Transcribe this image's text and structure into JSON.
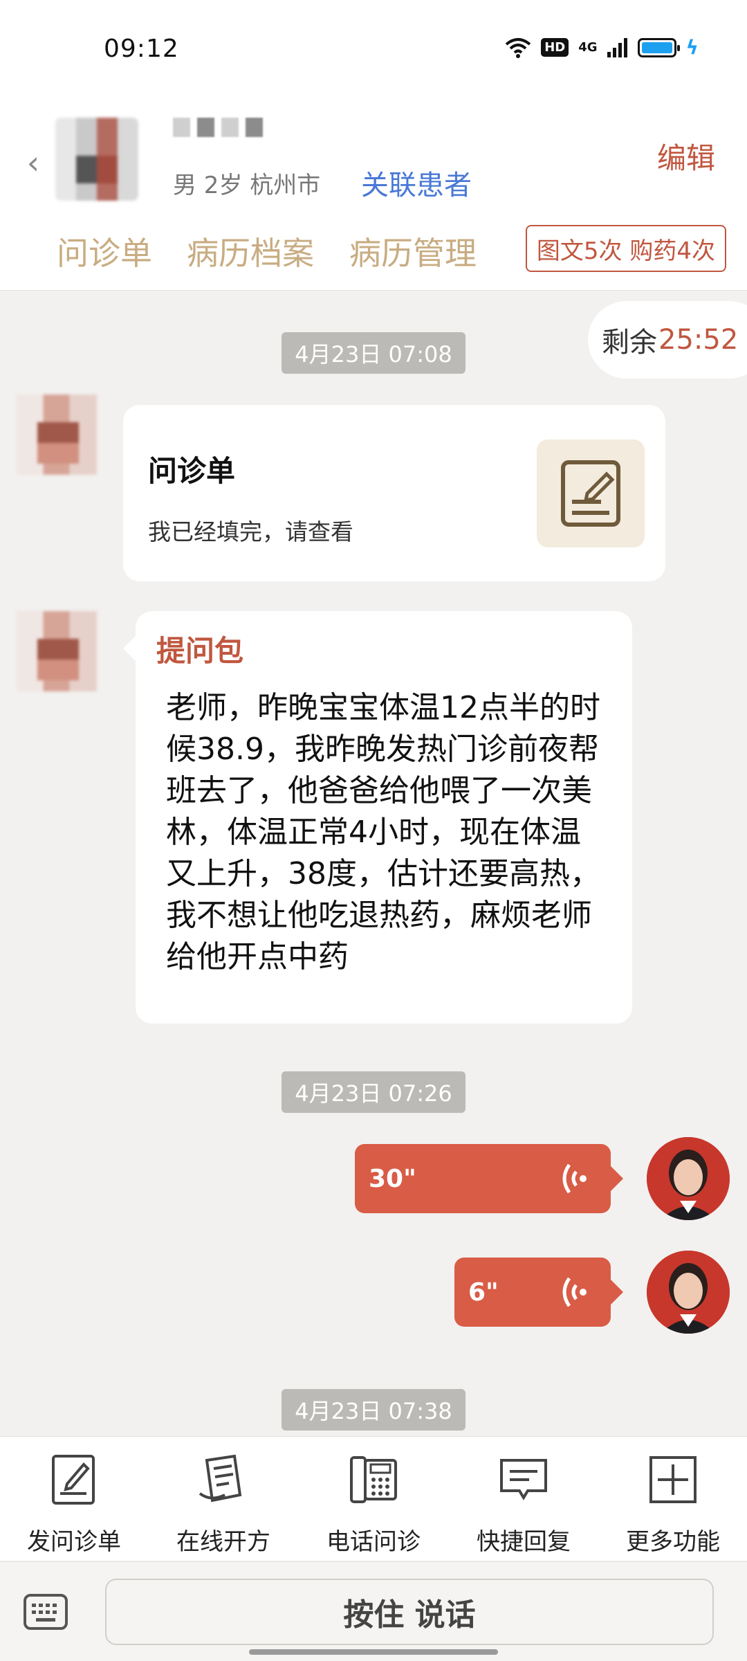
{
  "status_bar": {
    "time": "09:12",
    "hd": "HD",
    "network": "4G"
  },
  "header": {
    "patient_info": "男 2岁  杭州市",
    "link_patient": "关联患者",
    "edit": "编辑",
    "tabs": [
      {
        "label": "问诊单"
      },
      {
        "label": "病历档案"
      },
      {
        "label": "病历管理"
      }
    ],
    "quota": "图文5次 购药4次"
  },
  "timer": {
    "label": "剩余",
    "value": "25:52"
  },
  "messages": {
    "time1": "4月23日 07:08",
    "card_title": "问诊单",
    "card_sub": "我已经填完，请查看",
    "bubble_label": "提问包",
    "bubble_text": "老师，昨晚宝宝体温12点半的时候38.9，我昨晚发热门诊前夜帮班去了，他爸爸给他喂了一次美林，体温正常4小时，现在体温又上升，38度，估计还要高热，我不想让他吃退热药，麻烦老师给他开点中药",
    "time2": "4月23日 07:26",
    "voice1": "30\"",
    "voice2": "6\"",
    "time3": "4月23日 07:38"
  },
  "toolbar": {
    "items": [
      {
        "label": "发问诊单",
        "icon": "form-pen-icon"
      },
      {
        "label": "在线开方",
        "icon": "prescription-icon"
      },
      {
        "label": "电话问诊",
        "icon": "phone-icon"
      },
      {
        "label": "快捷回复",
        "icon": "chat-bubble-icon"
      },
      {
        "label": "更多功能",
        "icon": "plus-square-icon"
      }
    ]
  },
  "input": {
    "talk_button": "按住 说话"
  },
  "colors": {
    "accent": "#c0573f",
    "tab": "#c8ac82",
    "link": "#4a79d6",
    "voice": "#d95c46",
    "time_chip": "#bcbab6"
  }
}
